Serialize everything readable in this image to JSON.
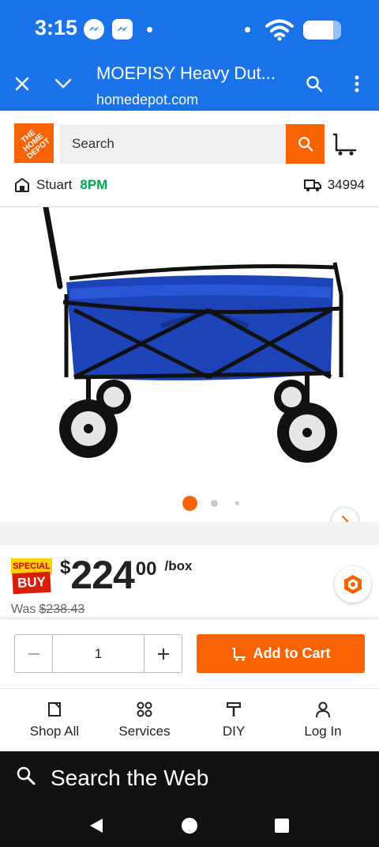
{
  "status_bar": {
    "time": "3:15",
    "battery_level": 0.8
  },
  "browser": {
    "page_title": "MOEPISY Heavy Dut...",
    "url": "homedepot.com"
  },
  "header": {
    "logo_text": "THE HOME DEPOT",
    "search_placeholder": "Search",
    "store_name": "Stuart",
    "store_hours": "8PM",
    "zip": "34994"
  },
  "gallery": {
    "image_count": 3,
    "active_index": 0
  },
  "price": {
    "badge_top": "SPECIAL",
    "badge_bottom": "BUY",
    "currency": "$",
    "dollars": "224",
    "cents": "00",
    "unit": "/box",
    "was_label": "Was",
    "was_price": "$238.43"
  },
  "cart": {
    "quantity": "1",
    "add_label": "Add to Cart"
  },
  "bottom_nav": {
    "items": [
      {
        "label": "Shop All",
        "icon": "shop-all-icon"
      },
      {
        "label": "Services",
        "icon": "services-icon"
      },
      {
        "label": "DIY",
        "icon": "diy-icon"
      },
      {
        "label": "Log In",
        "icon": "user-icon"
      }
    ]
  },
  "web_search": {
    "label": "Search the Web"
  },
  "colors": {
    "brand_orange": "#f96302",
    "chrome_blue": "#1a73e8",
    "store_green": "#00a650"
  }
}
